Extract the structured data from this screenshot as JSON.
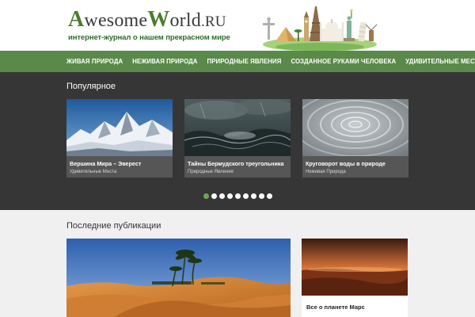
{
  "header": {
    "logo_awesome": "Awesome",
    "logo_world": "World",
    "logo_ru": ".ru",
    "tagline": "интернет-журнал о нашем прекрасном мире"
  },
  "nav": {
    "items": [
      "Живая природа",
      "Неживая природа",
      "Природные явления",
      "Созданное руками человека",
      "Удивительные места"
    ]
  },
  "popular": {
    "title": "Популярное",
    "cards": [
      {
        "title": "Вершина Мира – Эверест",
        "category": "Удивительные Места"
      },
      {
        "title": "Тайны Бермудского треугольника",
        "category": "Природные Явления"
      },
      {
        "title": "Круговорот воды в природе",
        "category": "Неживая Природа"
      }
    ],
    "pagination": {
      "count": 9,
      "active": 1
    }
  },
  "latest": {
    "title": "Последние публикации",
    "side_post": {
      "title": "Все о планете Марс"
    }
  },
  "colors": {
    "nav_bg": "#5a8a4a",
    "popular_bg": "#363636",
    "accent_dot": "#6aa84f",
    "latest_bg": "#f0f0f0"
  }
}
